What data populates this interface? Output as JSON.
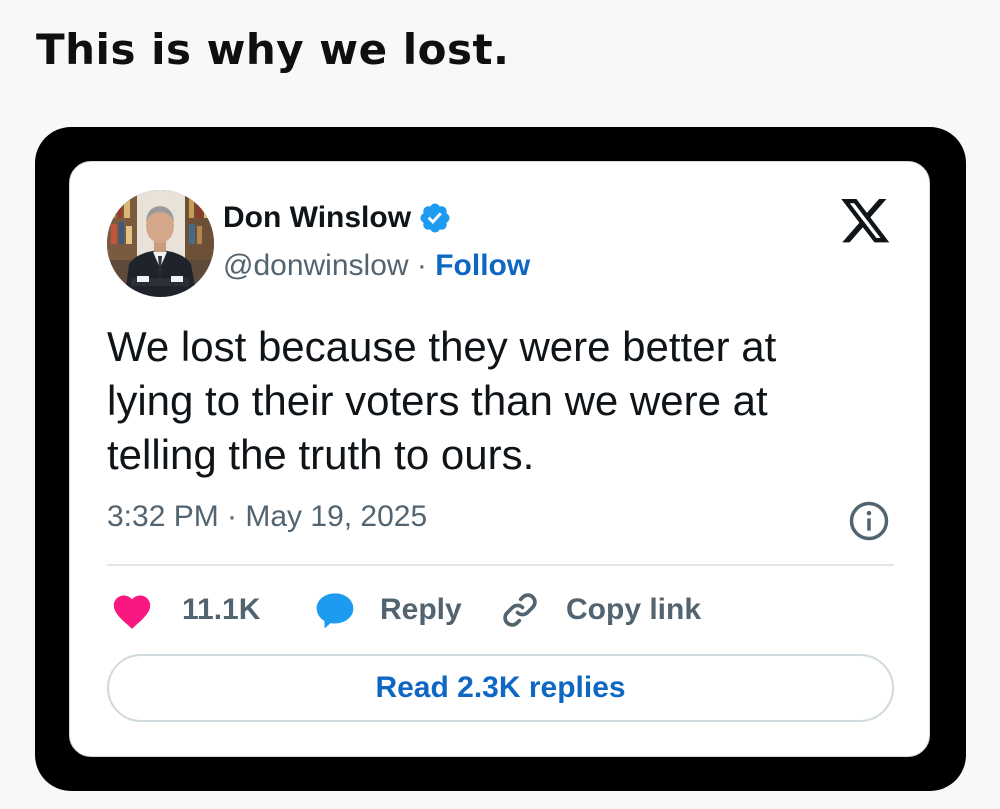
{
  "caption": "This is why we lost.",
  "tweet": {
    "author": {
      "name": "Don Winslow",
      "handle": "@donwinslow",
      "separator": "·",
      "follow_label": "Follow",
      "verified": true
    },
    "platform_icon": "x-logo-icon",
    "text": "We lost because they were better at lying to their voters than we were at telling the truth to ours.",
    "timestamp": "3:32 PM · May 19, 2025",
    "actions": {
      "likes_count": "11.1K",
      "reply_label": "Reply",
      "copy_link_label": "Copy link"
    },
    "read_replies_label": "Read 2.3K replies"
  },
  "colors": {
    "accent_blue": "#0f67c4",
    "like_pink": "#f91880",
    "reply_blue": "#1d9bf0",
    "verified_blue": "#1d9bf0",
    "text_primary": "#0f1419",
    "text_secondary": "#536471",
    "frame": "#000000"
  }
}
